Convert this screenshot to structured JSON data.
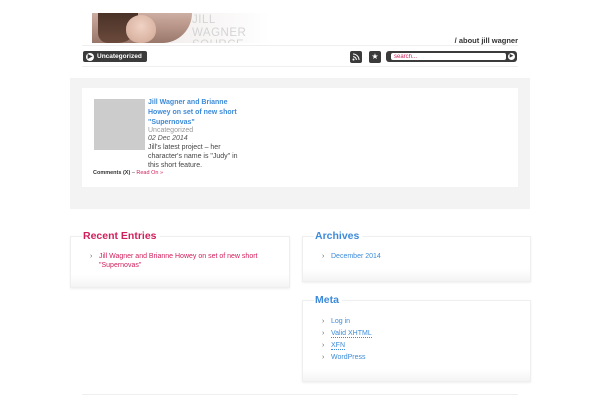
{
  "header": {
    "site_title": "JILL WAGNER SOURCE",
    "about_link": "/ about jill wagner"
  },
  "nav": {
    "category_label": "Uncategorized",
    "rss_icon": "rss-icon",
    "star_icon": "star-icon",
    "search_placeholder": "search..."
  },
  "post": {
    "title": "Jill Wagner and Brianne Howey on set of new short \"Supernovas\"",
    "category": "Uncategorized",
    "date": "02 Dec 2014",
    "excerpt": "Jill's latest project – her character's name is \"Judy\" in this short feature.",
    "comments_label": "Comments (X)",
    "separator": "–",
    "read_on": "Read On »"
  },
  "recent_entries": {
    "title": "Recent Entries",
    "items": [
      "Jill Wagner and Brianne Howey on set of new short \"Supernovas\""
    ]
  },
  "archives": {
    "title": "Archives",
    "items": [
      "December 2014"
    ]
  },
  "meta": {
    "title": "Meta",
    "items": [
      "Log in",
      "Valid XHTML",
      "XFN",
      "WordPress"
    ]
  },
  "colors": {
    "accent_pink": "#d0205c",
    "accent_blue": "#3d8bd8",
    "dark_button": "#3b3b3b"
  }
}
